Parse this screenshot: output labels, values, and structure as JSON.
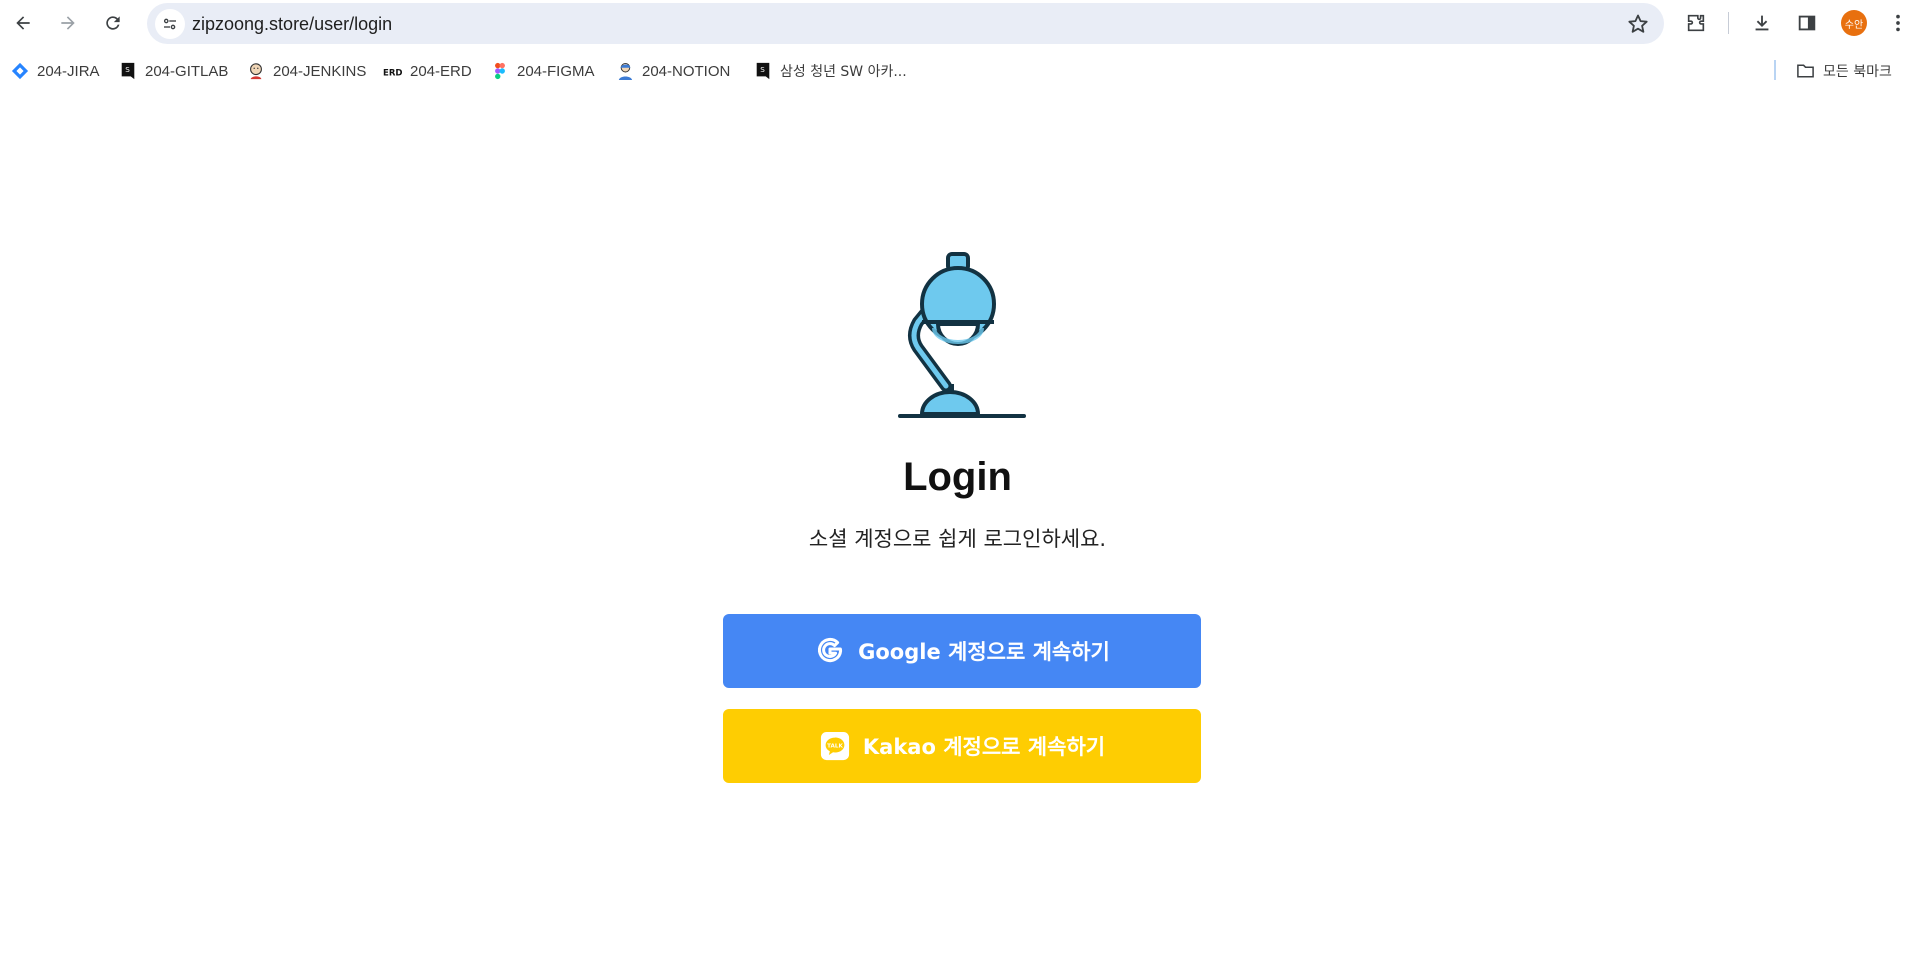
{
  "browser": {
    "url": "zipzoong.store/user/login",
    "profile_initials": "수안",
    "bookmarks": [
      {
        "label": "204-JIRA",
        "icon": "jira-icon"
      },
      {
        "label": "204-GITLAB",
        "icon": "gitlab-icon"
      },
      {
        "label": "204-JENKINS",
        "icon": "jenkins-icon"
      },
      {
        "label": "204-ERD",
        "icon": "erd-icon"
      },
      {
        "label": "204-FIGMA",
        "icon": "figma-icon"
      },
      {
        "label": "204-NOTION",
        "icon": "notion-icon"
      },
      {
        "label": "삼성 청년 SW 아카...",
        "icon": "ssafy-icon"
      }
    ],
    "all_bookmarks_label": "모든 북마크"
  },
  "login": {
    "logo": "desk-lamp-icon",
    "title": "Login",
    "subtitle": "소셜 계정으로 쉽게 로그인하세요.",
    "google_button": "Google 계정으로 계속하기",
    "kakao_button": "Kakao 계정으로 계속하기",
    "kakao_badge": "TALK"
  },
  "colors": {
    "google_button": "#4587f4",
    "kakao_button": "#fecd02",
    "lamp_blue": "#6ec9ee",
    "lamp_outline": "#123242"
  }
}
